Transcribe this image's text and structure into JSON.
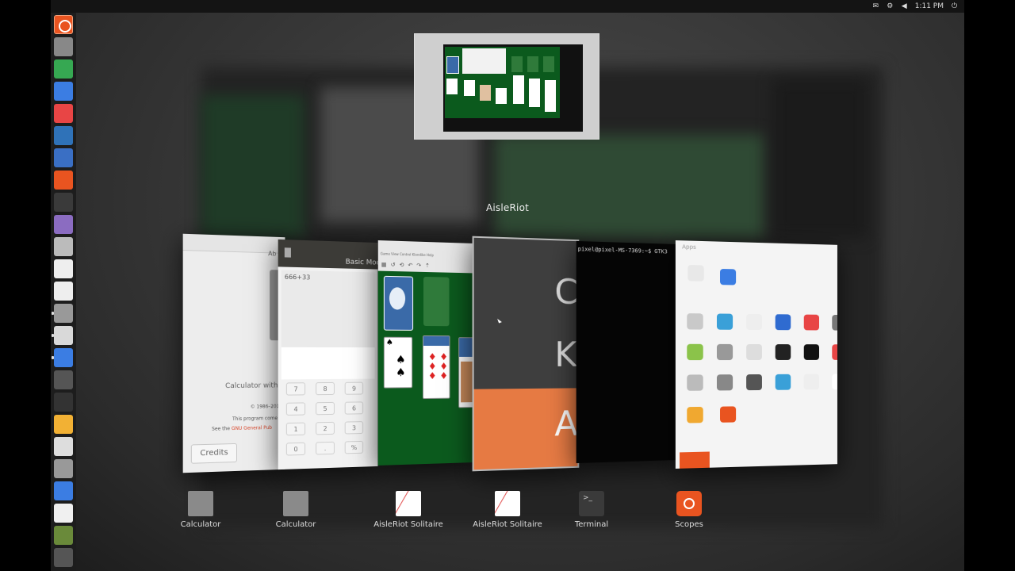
{
  "topbar": {
    "time": "1:11 PM",
    "indicators": [
      "mail-icon",
      "settings-icon",
      "volume-icon",
      "power-icon"
    ]
  },
  "launcher": {
    "items": [
      {
        "name": "ubuntu-dash-icon",
        "color": "#e95420"
      },
      {
        "name": "system-settings-icon",
        "color": "#888888"
      },
      {
        "name": "spreadsheet-icon",
        "color": "#36a852"
      },
      {
        "name": "drawing-icon",
        "color": "#3b7de3"
      },
      {
        "name": "music-icon",
        "color": "#e84545"
      },
      {
        "name": "weather-icon",
        "color": "#2f72b8"
      },
      {
        "name": "text-tool-icon",
        "color": "#3a6fc4"
      },
      {
        "name": "ubuntu-software-icon",
        "color": "#e95420"
      },
      {
        "name": "terminal-icon",
        "color": "#3a3a3a"
      },
      {
        "name": "diamond-icon",
        "color": "#8b6cc1"
      },
      {
        "name": "elephant-icon",
        "color": "#bbbbbb"
      },
      {
        "name": "text-editor-icon",
        "color": "#eeeeee"
      },
      {
        "name": "notes-icon",
        "color": "#eeeeee"
      },
      {
        "name": "calculator-icon",
        "color": "#999999"
      },
      {
        "name": "solitaire-cards-icon",
        "color": "#d9d9d9"
      },
      {
        "name": "image-viewer-icon",
        "color": "#3b7de3"
      },
      {
        "name": "globe-icon",
        "color": "#555555"
      },
      {
        "name": "cube-icon",
        "color": "#333333"
      },
      {
        "name": "emoji-icon",
        "color": "#f2b134"
      },
      {
        "name": "ball-icon",
        "color": "#dddddd"
      },
      {
        "name": "calculator-icon",
        "color": "#999999"
      },
      {
        "name": "drop-icon",
        "color": "#3b7de3"
      },
      {
        "name": "files-icon",
        "color": "#f0f0f0"
      },
      {
        "name": "disk-icon",
        "color": "#6a8a3a"
      },
      {
        "name": "trash-icon",
        "color": "#555555"
      }
    ]
  },
  "switcher": {
    "active_title": "AisleRiot",
    "windows": [
      {
        "label": "Calculator",
        "icon": "calculator-icon"
      },
      {
        "label": "Calculator",
        "icon": "calculator-icon"
      },
      {
        "label": "AisleRiot Solitaire",
        "icon": "solitaire-cards-icon"
      },
      {
        "label": "AisleRiot Solitaire",
        "icon": "solitaire-cards-icon"
      },
      {
        "label": "Terminal",
        "icon": "terminal-icon"
      },
      {
        "label": "Scopes",
        "icon": "ubuntu-scopes-icon"
      }
    ]
  },
  "calc_about": {
    "desc": "Calculator with fi",
    "copyright": "© 1986–201",
    "license1": "This program come",
    "license2": "See the",
    "license_link": "GNU General Pub",
    "credits": "Credits",
    "corner": "Ab"
  },
  "calc2": {
    "title": "Basic Mod",
    "display": "666+33",
    "keys": [
      "7",
      "8",
      "9",
      "4",
      "5",
      "6",
      "1",
      "2",
      "3",
      "0",
      ".",
      "%"
    ]
  },
  "aisleriot_card": {
    "menu": "Game  View  Control  Klondike  Help"
  },
  "terminal": {
    "prompt": "pixel@pixel-MS-7369:~$ GTK3"
  },
  "login_card": {
    "big1": "C",
    "big2": "K",
    "big3": "A"
  },
  "apps_card": {
    "title": "Apps"
  },
  "colors": {
    "ubuntu_orange": "#e95420",
    "felt": "#0b5a1d"
  }
}
